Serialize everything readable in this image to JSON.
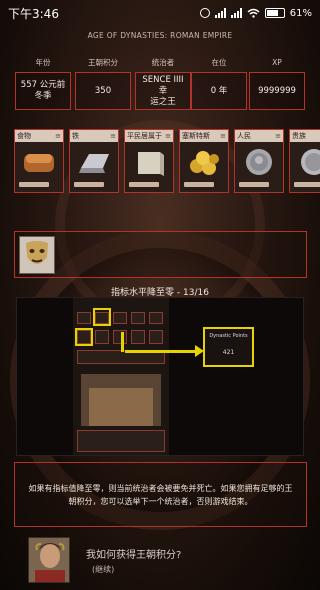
{
  "status_bar": {
    "time": "下午3:46",
    "battery": "61%"
  },
  "subtitle": "AGE OF DYNASTIES: ROMAN EMPIRE",
  "stats": [
    {
      "label": "年份",
      "value": "557 公元前\n冬季"
    },
    {
      "label": "王朝积分",
      "value": "350"
    },
    {
      "label": "统治者",
      "value": "SENCE IIII 幸\n运之王"
    },
    {
      "label": "在位",
      "value": "0 年"
    },
    {
      "label": "XP",
      "value": "9999999"
    }
  ],
  "resources": [
    {
      "label": "食物",
      "icon": "bread-icon"
    },
    {
      "label": "铁",
      "icon": "iron-ingot-icon"
    },
    {
      "label": "平民居属于",
      "icon": "stone-block-icon"
    },
    {
      "label": "塞斯特斯",
      "icon": "gold-coins-icon"
    },
    {
      "label": "人民",
      "icon": "silver-coin-icon"
    },
    {
      "label": "贵族",
      "icon": "noble-coin-icon"
    }
  ],
  "leader_panel": {
    "icon": "theater-mask-icon"
  },
  "tutorial": {
    "title": "指标水平降至零 - 13/16",
    "image": {
      "dynastic_points_label": "Dynastic Points",
      "dynastic_points_value": "421"
    }
  },
  "description": "如果有指标值降至零，则当前统治者会被要免并死亡。如果您拥有足够的王朝积分，您可以选举下一个统治者，否则游戏结束。",
  "advisor": {
    "question": "我如何获得王朝积分?",
    "continue": "(继续)"
  }
}
